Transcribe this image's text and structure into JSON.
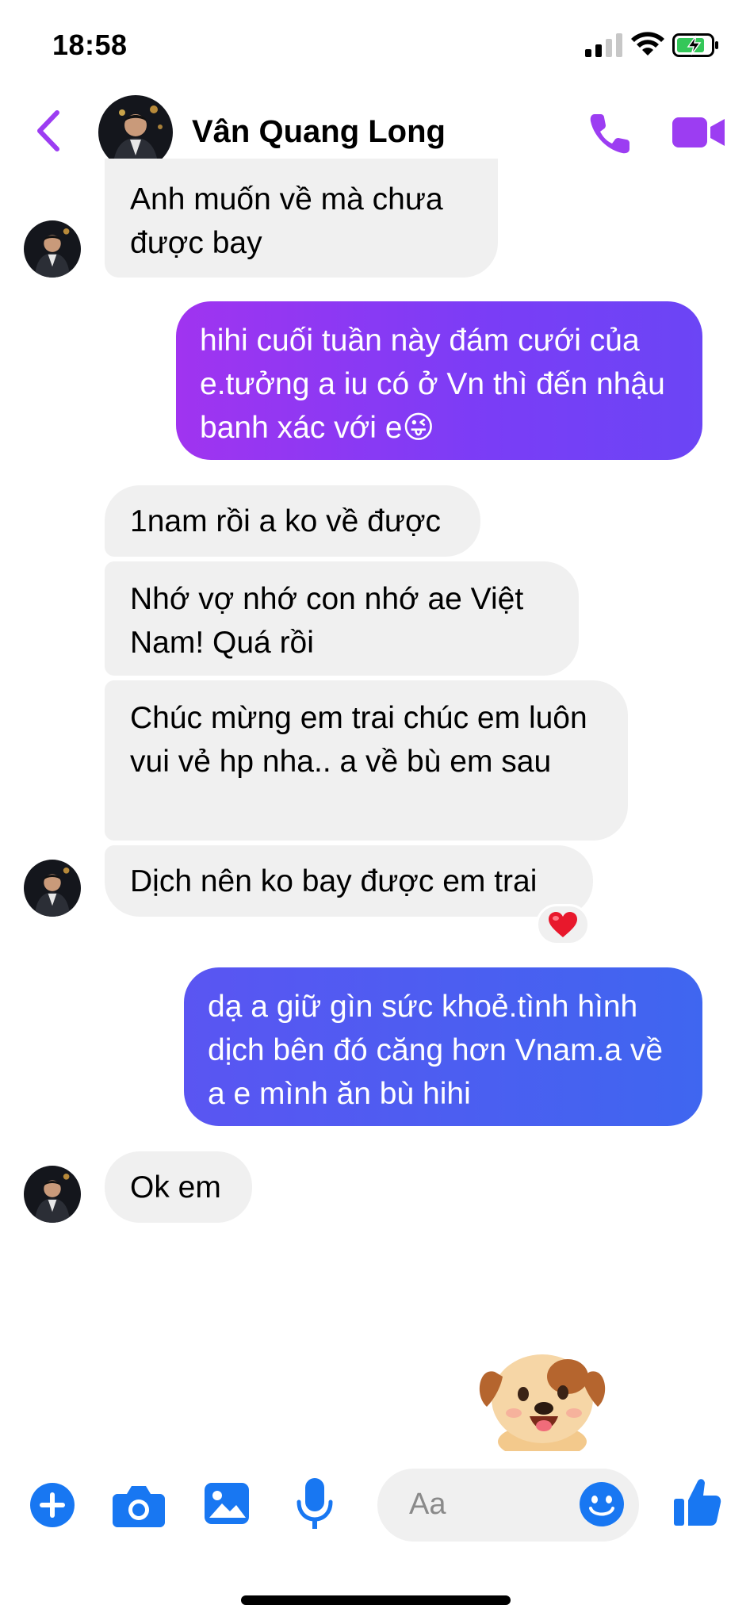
{
  "status_bar": {
    "time": "18:58"
  },
  "header": {
    "contact_name": "Vân Quang Long",
    "accent_color": "#9c3df2"
  },
  "messages": [
    {
      "side": "in",
      "text": "Anh muốn về mà chưa được bay"
    },
    {
      "side": "out",
      "text": "hihi cuối tuần này đám cưới của e.tưởng a iu có ở Vn thì đến nhậu banh xác với e😜"
    },
    {
      "side": "in",
      "text": "1nam rồi a ko về được"
    },
    {
      "side": "in",
      "text": "Nhớ vợ nhớ con nhớ ae Việt Nam! Quá rồi"
    },
    {
      "side": "in",
      "text": "Chúc mừng em trai chúc em luôn vui vẻ hp nha.. a về bù em sau"
    },
    {
      "side": "in",
      "text": "Dịch nên ko bay được em trai",
      "reaction": "❤️"
    },
    {
      "side": "out",
      "text": "dạ a giữ gìn sức khoẻ.tình hình dịch bên đó căng hơn Vnam.a về a e mình ăn bù hihi"
    },
    {
      "side": "in",
      "text": "Ok em"
    }
  ],
  "composer": {
    "placeholder": "Aa",
    "accent_color": "#1877f2",
    "icons": [
      "plus-icon",
      "camera-icon",
      "image-icon",
      "microphone-icon",
      "emoji-icon",
      "thumbs-up-icon"
    ]
  }
}
